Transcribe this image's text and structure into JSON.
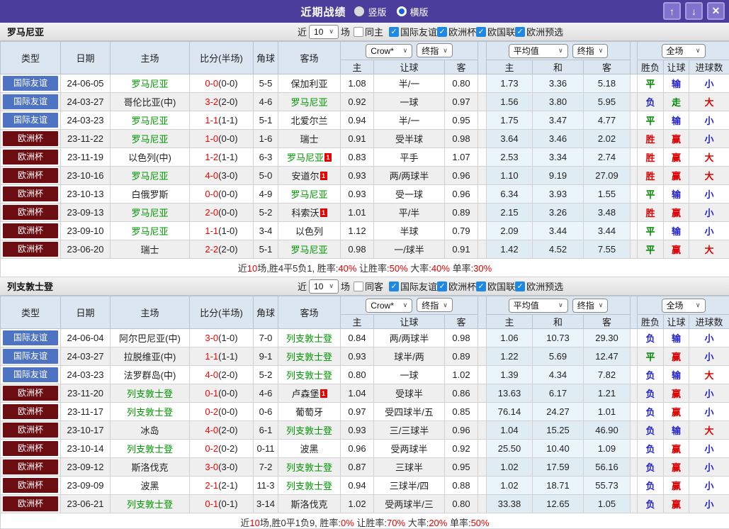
{
  "titlebar": {
    "title": "近期战绩",
    "options": [
      {
        "label": "竖版",
        "selected": false
      },
      {
        "label": "横版",
        "selected": true
      }
    ],
    "buttons": {
      "up": "↑",
      "down": "↓",
      "close": "✕"
    }
  },
  "filters": {
    "near_label": "近",
    "matches_label": "场",
    "check_glyph": "✓",
    "dropdown_glyph": "∨",
    "leagues": [
      "国际友谊",
      "欧洲杯",
      "欧国联",
      "欧洲预选"
    ]
  },
  "table": {
    "main_headers": [
      "类型",
      "日期",
      "主场",
      "比分(半场)",
      "角球",
      "客场"
    ],
    "odds_group": {
      "company": "Crow*",
      "final": "终指",
      "sub": [
        "主",
        "让球",
        "客"
      ]
    },
    "avg_group": {
      "company": "平均值",
      "final": "终指",
      "sub": [
        "主",
        "和",
        "客"
      ]
    },
    "result_group": {
      "scope": "全场",
      "sub": [
        "胜负",
        "让球",
        "进球数"
      ]
    }
  },
  "colors": {
    "titlebar_bg": "#4b3d9c",
    "titlebar_button_bg": "#8173cd",
    "friendly_bg": "#4e73c3",
    "eurocup_bg": "#6c0d12",
    "team_highlight": "#009900",
    "score_red": "#ff0000",
    "checkbox_blue": "#1e88e5",
    "summary_red": "#e80000",
    "result_map": {
      "胜": "#dd0000",
      "赢": "#dd0000",
      "大": "#dd0000",
      "平": "#008800",
      "走": "#008800",
      "负": "#2424cc",
      "输": "#2424cc",
      "小": "#2424cc"
    }
  },
  "sections": [
    {
      "team": "罗马尼亚",
      "match_count": "10",
      "same_label": "同主",
      "same_checked": false,
      "rows": [
        {
          "type": "国际友谊",
          "cat": "friendly",
          "date": "24-06-05",
          "home": "罗马尼亚",
          "home_hl": true,
          "home_badge": "",
          "score": "0-0",
          "half": "(0-0)",
          "corners": "5-5",
          "away": "保加利亚",
          "away_hl": false,
          "away_badge": "",
          "odds": [
            "1.08",
            "半/一",
            "0.80"
          ],
          "avg": [
            "1.73",
            "3.36",
            "5.18"
          ],
          "results": [
            "平",
            "输",
            "小"
          ]
        },
        {
          "type": "国际友谊",
          "cat": "friendly",
          "date": "24-03-27",
          "home": "哥伦比亚(中)",
          "home_hl": false,
          "home_badge": "",
          "score": "3-2",
          "half": "(2-0)",
          "corners": "4-6",
          "away": "罗马尼亚",
          "away_hl": true,
          "away_badge": "",
          "odds": [
            "0.92",
            "一球",
            "0.97"
          ],
          "avg": [
            "1.56",
            "3.80",
            "5.95"
          ],
          "results": [
            "负",
            "走",
            "大"
          ]
        },
        {
          "type": "国际友谊",
          "cat": "friendly",
          "date": "24-03-23",
          "home": "罗马尼亚",
          "home_hl": true,
          "home_badge": "",
          "score": "1-1",
          "half": "(1-1)",
          "corners": "5-1",
          "away": "北爱尔兰",
          "away_hl": false,
          "away_badge": "",
          "odds": [
            "0.94",
            "半/一",
            "0.95"
          ],
          "avg": [
            "1.75",
            "3.47",
            "4.77"
          ],
          "results": [
            "平",
            "输",
            "小"
          ]
        },
        {
          "type": "欧洲杯",
          "cat": "eurocup",
          "date": "23-11-22",
          "home": "罗马尼亚",
          "home_hl": true,
          "home_badge": "",
          "score": "1-0",
          "half": "(0-0)",
          "corners": "1-6",
          "away": "瑞士",
          "away_hl": false,
          "away_badge": "",
          "odds": [
            "0.91",
            "受半球",
            "0.98"
          ],
          "avg": [
            "3.64",
            "3.46",
            "2.02"
          ],
          "results": [
            "胜",
            "赢",
            "小"
          ]
        },
        {
          "type": "欧洲杯",
          "cat": "eurocup",
          "date": "23-11-19",
          "home": "以色列(中)",
          "home_hl": false,
          "home_badge": "",
          "score": "1-2",
          "half": "(1-1)",
          "corners": "6-3",
          "away": "罗马尼亚",
          "away_hl": true,
          "away_badge": "1",
          "odds": [
            "0.83",
            "平手",
            "1.07"
          ],
          "avg": [
            "2.53",
            "3.34",
            "2.74"
          ],
          "results": [
            "胜",
            "赢",
            "大"
          ]
        },
        {
          "type": "欧洲杯",
          "cat": "eurocup",
          "date": "23-10-16",
          "home": "罗马尼亚",
          "home_hl": true,
          "home_badge": "",
          "score": "4-0",
          "half": "(3-0)",
          "corners": "5-0",
          "away": "安道尔",
          "away_hl": false,
          "away_badge": "1",
          "odds": [
            "0.93",
            "两/两球半",
            "0.96"
          ],
          "avg": [
            "1.10",
            "9.19",
            "27.09"
          ],
          "results": [
            "胜",
            "赢",
            "大"
          ]
        },
        {
          "type": "欧洲杯",
          "cat": "eurocup",
          "date": "23-10-13",
          "home": "白俄罗斯",
          "home_hl": false,
          "home_badge": "",
          "score": "0-0",
          "half": "(0-0)",
          "corners": "4-9",
          "away": "罗马尼亚",
          "away_hl": true,
          "away_badge": "",
          "odds": [
            "0.93",
            "受一球",
            "0.96"
          ],
          "avg": [
            "6.34",
            "3.93",
            "1.55"
          ],
          "results": [
            "平",
            "输",
            "小"
          ]
        },
        {
          "type": "欧洲杯",
          "cat": "eurocup",
          "date": "23-09-13",
          "home": "罗马尼亚",
          "home_hl": true,
          "home_badge": "",
          "score": "2-0",
          "half": "(0-0)",
          "corners": "5-2",
          "away": "科索沃",
          "away_hl": false,
          "away_badge": "1",
          "odds": [
            "1.01",
            "平/半",
            "0.89"
          ],
          "avg": [
            "2.15",
            "3.26",
            "3.48"
          ],
          "results": [
            "胜",
            "赢",
            "小"
          ]
        },
        {
          "type": "欧洲杯",
          "cat": "eurocup",
          "date": "23-09-10",
          "home": "罗马尼亚",
          "home_hl": true,
          "home_badge": "",
          "score": "1-1",
          "half": "(1-0)",
          "corners": "3-4",
          "away": "以色列",
          "away_hl": false,
          "away_badge": "",
          "odds": [
            "1.12",
            "半球",
            "0.79"
          ],
          "avg": [
            "2.09",
            "3.44",
            "3.44"
          ],
          "results": [
            "平",
            "输",
            "小"
          ]
        },
        {
          "type": "欧洲杯",
          "cat": "eurocup",
          "date": "23-06-20",
          "home": "瑞士",
          "home_hl": false,
          "home_badge": "",
          "score": "2-2",
          "half": "(2-0)",
          "corners": "5-1",
          "away": "罗马尼亚",
          "away_hl": true,
          "away_badge": "",
          "odds": [
            "0.98",
            "一/球半",
            "0.91"
          ],
          "avg": [
            "1.42",
            "4.52",
            "7.55"
          ],
          "results": [
            "平",
            "赢",
            "大"
          ]
        }
      ],
      "summary": [
        {
          "t": "近",
          "c": "k"
        },
        {
          "t": "10",
          "c": "r"
        },
        {
          "t": "场,胜4平5负1, 胜率:",
          "c": "k"
        },
        {
          "t": "40%",
          "c": "r"
        },
        {
          "t": " 让胜率:",
          "c": "k"
        },
        {
          "t": "50%",
          "c": "r"
        },
        {
          "t": " 大率:",
          "c": "k"
        },
        {
          "t": "40%",
          "c": "r"
        },
        {
          "t": " 单率:",
          "c": "k"
        },
        {
          "t": "30%",
          "c": "r"
        }
      ]
    },
    {
      "team": "列支敦士登",
      "match_count": "10",
      "same_label": "同客",
      "same_checked": false,
      "rows": [
        {
          "type": "国际友谊",
          "cat": "friendly",
          "date": "24-06-04",
          "home": "阿尔巴尼亚(中)",
          "home_hl": false,
          "home_badge": "",
          "score": "3-0",
          "half": "(1-0)",
          "corners": "7-0",
          "away": "列支敦士登",
          "away_hl": true,
          "away_badge": "",
          "odds": [
            "0.84",
            "两/两球半",
            "0.98"
          ],
          "avg": [
            "1.06",
            "10.73",
            "29.30"
          ],
          "results": [
            "负",
            "输",
            "小"
          ]
        },
        {
          "type": "国际友谊",
          "cat": "friendly",
          "date": "24-03-27",
          "home": "拉脱维亚(中)",
          "home_hl": false,
          "home_badge": "",
          "score": "1-1",
          "half": "(1-1)",
          "corners": "9-1",
          "away": "列支敦士登",
          "away_hl": true,
          "away_badge": "",
          "odds": [
            "0.93",
            "球半/两",
            "0.89"
          ],
          "avg": [
            "1.22",
            "5.69",
            "12.47"
          ],
          "results": [
            "平",
            "赢",
            "小"
          ]
        },
        {
          "type": "国际友谊",
          "cat": "friendly",
          "date": "24-03-23",
          "home": "法罗群岛(中)",
          "home_hl": false,
          "home_badge": "",
          "score": "4-0",
          "half": "(2-0)",
          "corners": "5-2",
          "away": "列支敦士登",
          "away_hl": true,
          "away_badge": "",
          "odds": [
            "0.80",
            "一球",
            "1.02"
          ],
          "avg": [
            "1.39",
            "4.34",
            "7.82"
          ],
          "results": [
            "负",
            "输",
            "大"
          ]
        },
        {
          "type": "欧洲杯",
          "cat": "eurocup",
          "date": "23-11-20",
          "home": "列支敦士登",
          "home_hl": true,
          "home_badge": "",
          "score": "0-1",
          "half": "(0-0)",
          "corners": "4-6",
          "away": "卢森堡",
          "away_hl": false,
          "away_badge": "1",
          "odds": [
            "1.04",
            "受球半",
            "0.86"
          ],
          "avg": [
            "13.63",
            "6.17",
            "1.21"
          ],
          "results": [
            "负",
            "赢",
            "小"
          ]
        },
        {
          "type": "欧洲杯",
          "cat": "eurocup",
          "date": "23-11-17",
          "home": "列支敦士登",
          "home_hl": true,
          "home_badge": "",
          "score": "0-2",
          "half": "(0-0)",
          "corners": "0-6",
          "away": "葡萄牙",
          "away_hl": false,
          "away_badge": "",
          "odds": [
            "0.97",
            "受四球半/五",
            "0.85"
          ],
          "avg": [
            "76.14",
            "24.27",
            "1.01"
          ],
          "results": [
            "负",
            "赢",
            "小"
          ]
        },
        {
          "type": "欧洲杯",
          "cat": "eurocup",
          "date": "23-10-17",
          "home": "冰岛",
          "home_hl": false,
          "home_badge": "",
          "score": "4-0",
          "half": "(2-0)",
          "corners": "6-1",
          "away": "列支敦士登",
          "away_hl": true,
          "away_badge": "",
          "odds": [
            "0.93",
            "三/三球半",
            "0.96"
          ],
          "avg": [
            "1.04",
            "15.25",
            "46.90"
          ],
          "results": [
            "负",
            "输",
            "大"
          ]
        },
        {
          "type": "欧洲杯",
          "cat": "eurocup",
          "date": "23-10-14",
          "home": "列支敦士登",
          "home_hl": true,
          "home_badge": "",
          "score": "0-2",
          "half": "(0-2)",
          "corners": "0-11",
          "away": "波黑",
          "away_hl": false,
          "away_badge": "",
          "odds": [
            "0.96",
            "受两球半",
            "0.92"
          ],
          "avg": [
            "25.50",
            "10.40",
            "1.09"
          ],
          "results": [
            "负",
            "赢",
            "小"
          ]
        },
        {
          "type": "欧洲杯",
          "cat": "eurocup",
          "date": "23-09-12",
          "home": "斯洛伐克",
          "home_hl": false,
          "home_badge": "",
          "score": "3-0",
          "half": "(3-0)",
          "corners": "7-2",
          "away": "列支敦士登",
          "away_hl": true,
          "away_badge": "",
          "odds": [
            "0.87",
            "三球半",
            "0.95"
          ],
          "avg": [
            "1.02",
            "17.59",
            "56.16"
          ],
          "results": [
            "负",
            "赢",
            "小"
          ]
        },
        {
          "type": "欧洲杯",
          "cat": "eurocup",
          "date": "23-09-09",
          "home": "波黑",
          "home_hl": false,
          "home_badge": "",
          "score": "2-1",
          "half": "(2-1)",
          "corners": "11-3",
          "away": "列支敦士登",
          "away_hl": true,
          "away_badge": "",
          "odds": [
            "0.94",
            "三球半/四",
            "0.88"
          ],
          "avg": [
            "1.02",
            "18.71",
            "55.73"
          ],
          "results": [
            "负",
            "赢",
            "小"
          ]
        },
        {
          "type": "欧洲杯",
          "cat": "eurocup",
          "date": "23-06-21",
          "home": "列支敦士登",
          "home_hl": true,
          "home_badge": "",
          "score": "0-1",
          "half": "(0-1)",
          "corners": "3-14",
          "away": "斯洛伐克",
          "away_hl": false,
          "away_badge": "",
          "odds": [
            "1.02",
            "受两球半/三",
            "0.80"
          ],
          "avg": [
            "33.38",
            "12.65",
            "1.05"
          ],
          "results": [
            "负",
            "赢",
            "小"
          ]
        }
      ],
      "summary": [
        {
          "t": "近",
          "c": "k"
        },
        {
          "t": "10",
          "c": "r"
        },
        {
          "t": "场,胜0平1负9, 胜率:",
          "c": "k"
        },
        {
          "t": "0%",
          "c": "r"
        },
        {
          "t": " 让胜率:",
          "c": "k"
        },
        {
          "t": "70%",
          "c": "r"
        },
        {
          "t": " 大率:",
          "c": "k"
        },
        {
          "t": "20%",
          "c": "r"
        },
        {
          "t": " 单率:",
          "c": "k"
        },
        {
          "t": "50%",
          "c": "r"
        }
      ]
    }
  ]
}
